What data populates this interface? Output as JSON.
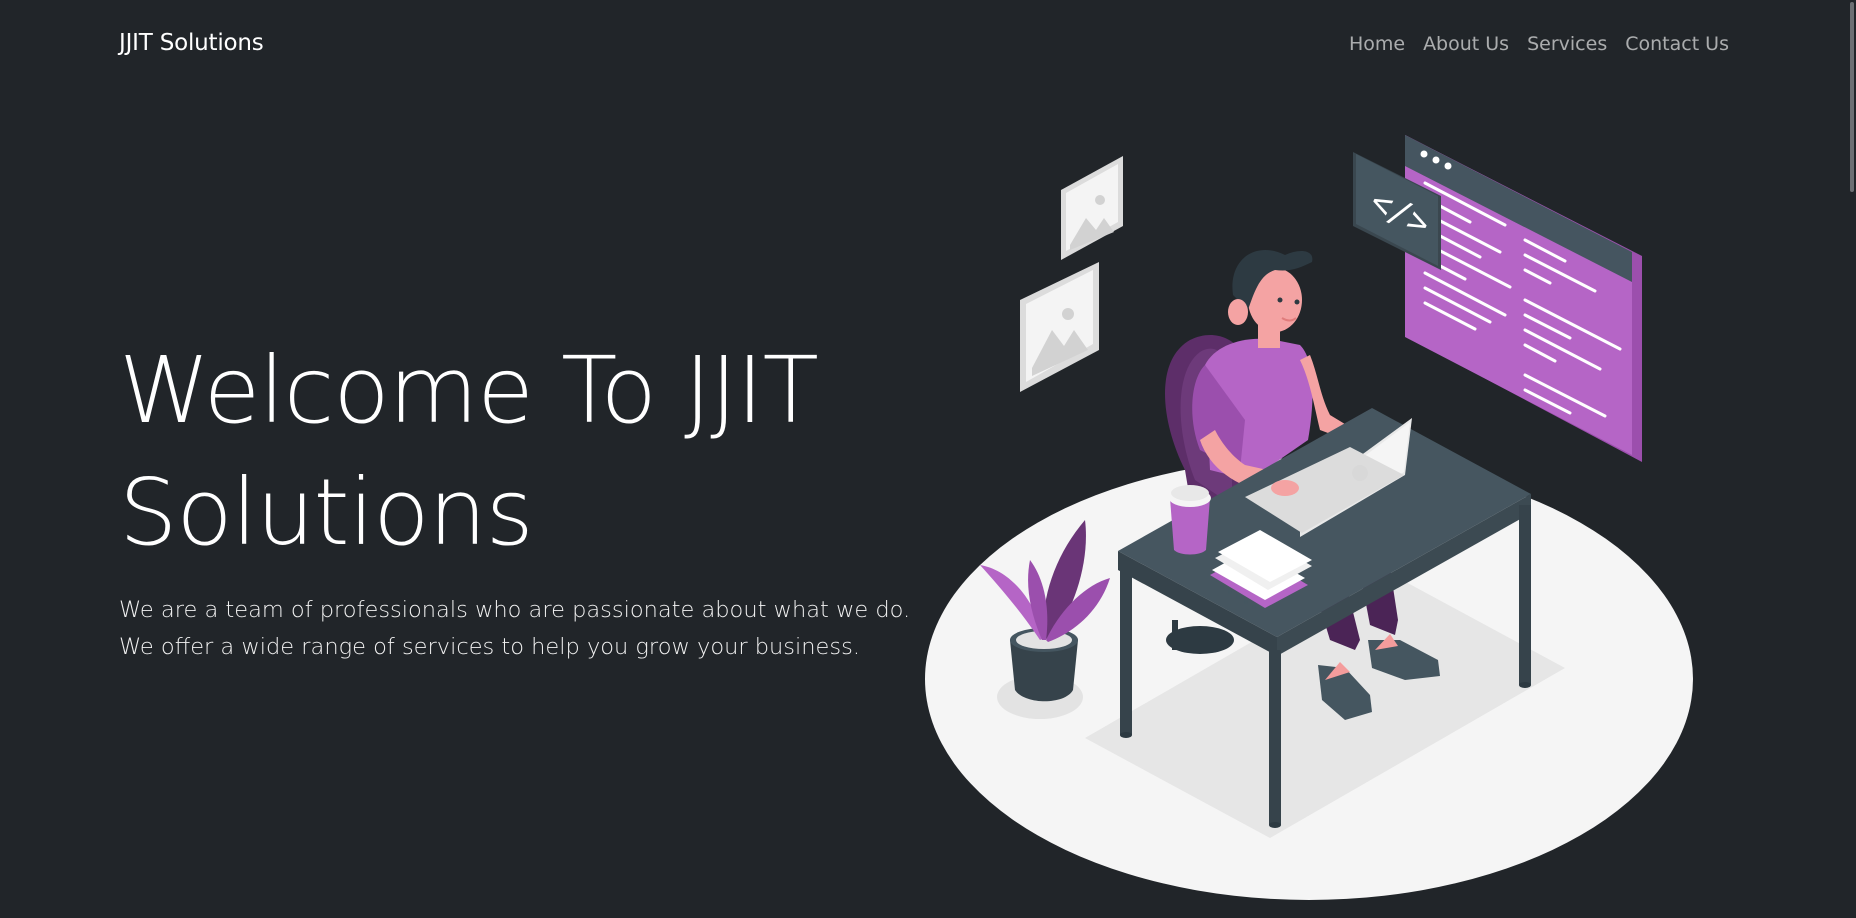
{
  "navbar": {
    "brand": "JJIT Solutions",
    "links": [
      {
        "label": "Home"
      },
      {
        "label": "About Us"
      },
      {
        "label": "Services"
      },
      {
        "label": "Contact Us"
      }
    ]
  },
  "hero": {
    "title_line1": "Welcome To JJIT",
    "title_line2": "Solutions",
    "lead_line1": "We are a team of professionals who are passionate about what we do.",
    "lead_line2": "We offer a wide range of services to help you grow your business."
  },
  "illustration": {
    "code_symbol": "</>",
    "icons": [
      "image-frame-icon",
      "image-frame-icon",
      "code-window-icon",
      "browser-window-icon",
      "laptop-icon",
      "plant-icon",
      "cup-icon",
      "notebook-icon"
    ]
  },
  "colors": {
    "background": "#212529",
    "accent": "#b565c6",
    "desk": "#465660",
    "floor": "#f5f5f5"
  }
}
